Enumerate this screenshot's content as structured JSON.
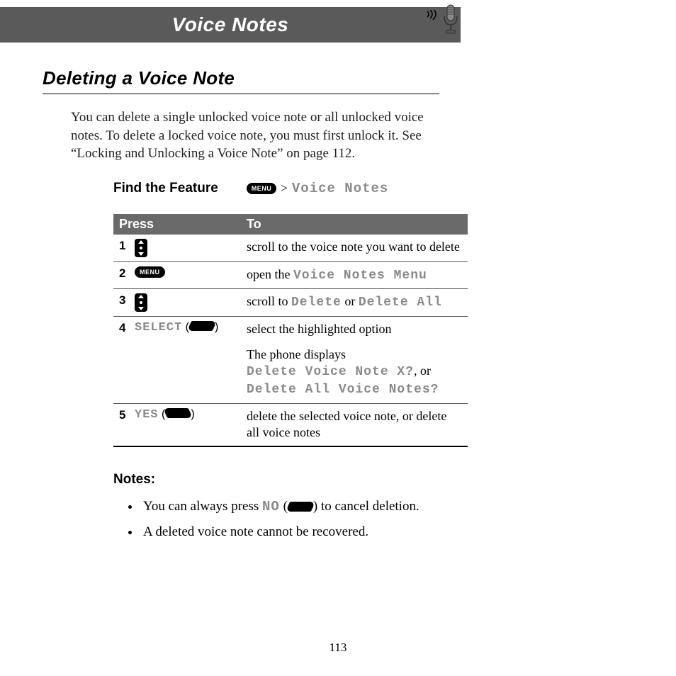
{
  "header": {
    "title": "Voice Notes"
  },
  "section": {
    "title": "Deleting a Voice Note",
    "intro": "You can delete a single unlocked voice note or all unlocked voice notes. To delete a locked voice note, you must first unlock it. See “Locking and Unlocking a Voice Note” on page 112."
  },
  "find_feature": {
    "label": "Find the Feature",
    "key": "MENU",
    "gt": ">",
    "path": "Voice Notes"
  },
  "table": {
    "head_press": "Press",
    "head_to": "To",
    "rows": [
      {
        "num": "1",
        "press_type": "scroll",
        "to_pre": "scroll to the voice note you want to delete"
      },
      {
        "num": "2",
        "press_type": "menu",
        "press_label": "MENU",
        "to_pre": "open the ",
        "to_mono1": "Voice Notes Menu"
      },
      {
        "num": "3",
        "press_type": "scroll",
        "to_pre": "scroll to ",
        "to_mono1": "Delete",
        "to_mid": " or ",
        "to_mono2": "Delete All"
      },
      {
        "num": "4",
        "press_type": "softright",
        "press_soft": "SELECT",
        "to_pre": "select the highlighted option",
        "extra_pre": "The phone displays",
        "extra_mono1": "Delete Voice Note X?",
        "extra_mid": ", or",
        "extra_mono2": "Delete All Voice Notes?"
      },
      {
        "num": "5",
        "press_type": "softleft",
        "press_soft": "YES",
        "to_pre": "delete the selected voice note, or delete all voice notes"
      }
    ]
  },
  "notes": {
    "label": "Notes:",
    "items": [
      {
        "pre": "You can always press ",
        "mono": "NO",
        "paren_open": " (",
        "paren_close": ")",
        "post": " to cancel deletion."
      },
      {
        "pre": "A deleted voice note cannot be recovered."
      }
    ]
  },
  "page_number": "113"
}
